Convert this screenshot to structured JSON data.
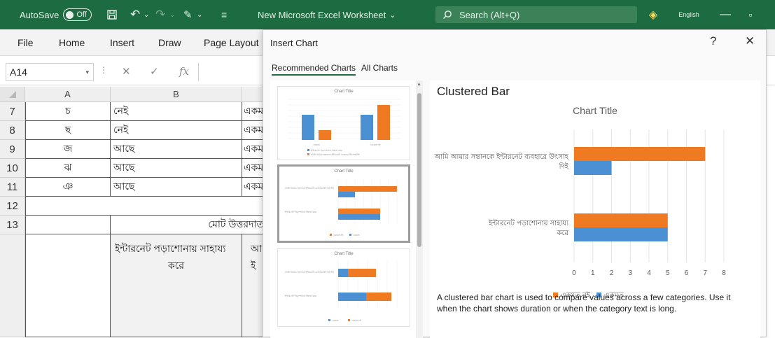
{
  "titlebar": {
    "autosave_label": "AutoSave",
    "autosave_state": "Off",
    "doc_title": "New Microsoft Excel Worksheet",
    "search_placeholder": "Search (Alt+Q)",
    "language": "English"
  },
  "ribbon_tabs": [
    "File",
    "Home",
    "Insert",
    "Draw",
    "Page Layout"
  ],
  "formula_bar": {
    "name_box": "A14",
    "fx": "fx"
  },
  "sheet": {
    "columns": [
      "A",
      "B"
    ],
    "rows": [
      {
        "num": "7",
        "a": "চ",
        "b": "নেই",
        "c": "একম"
      },
      {
        "num": "8",
        "a": "ছ",
        "b": "নেই",
        "c": "একম"
      },
      {
        "num": "9",
        "a": "জ",
        "b": "আছে",
        "c": "একম"
      },
      {
        "num": "10",
        "a": "ঝ",
        "b": "আছে",
        "c": "একম"
      },
      {
        "num": "11",
        "a": "ঞ",
        "b": "আছে",
        "c": "একম"
      },
      {
        "num": "12",
        "a": "",
        "b": "",
        "c": ""
      },
      {
        "num": "13",
        "a": "",
        "b": "মোট উত্তরদাত",
        "c": ""
      }
    ],
    "row14": {
      "b_line1": "ইন্টারনেট পড়াশোনায় সাহায্য",
      "b_line2": "করে",
      "c_line1": "আ",
      "c_line2": "ই"
    }
  },
  "dialog": {
    "title": "Insert Chart",
    "help": "?",
    "close": "✕",
    "tabs": [
      "Recommended Charts",
      "All Charts"
    ],
    "thumb_title": "Chart Title",
    "thumb_cats": [
      "একমত",
      "একমত নই"
    ],
    "thumb_legend": [
      "ইন্টারনেট পড়াশোনায় সাহায্য করে",
      "আমি আমার সন্তানকে ইন্টারনেট ব্যবহারে উৎসাহ দিই"
    ],
    "preview_heading": "Clustered Bar",
    "description": "A clustered bar chart is used to compare values across a few categories. Use it when the chart shows duration or when the category text is long."
  },
  "colors": {
    "orange": "#f07a22",
    "blue": "#4a90d2",
    "excel_green": "#1d6b40"
  },
  "chart_data": {
    "type": "bar",
    "orientation": "horizontal",
    "title": "Chart Title",
    "categories": [
      "আমি আমার সন্তানকে ইন্টারনেট ব্যবহারে উৎসাহ দিই",
      "ইন্টারনেট পড়াশোনায় সাহায্য করে"
    ],
    "series": [
      {
        "name": "একমত নই",
        "values": [
          7,
          5
        ],
        "color": "#f07a22"
      },
      {
        "name": "একমত",
        "values": [
          2,
          5
        ],
        "color": "#4a90d2"
      }
    ],
    "xlim": [
      0,
      8
    ],
    "xticks": [
      "0",
      "1",
      "2",
      "3",
      "4",
      "5",
      "6",
      "7",
      "8"
    ],
    "grid": true,
    "legend": "bottom"
  }
}
